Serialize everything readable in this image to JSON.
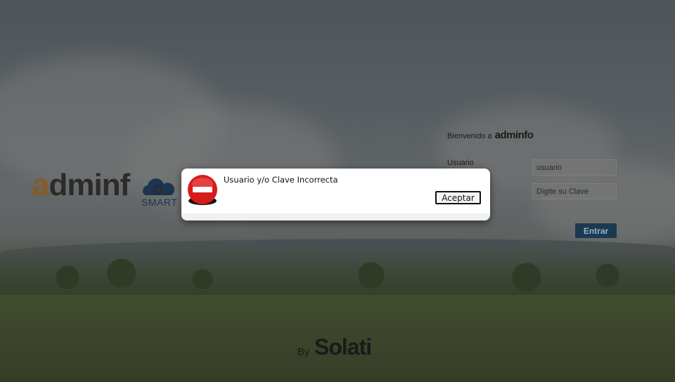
{
  "brand": {
    "logo_main_a": "a",
    "logo_main_rest": "dminf",
    "logo_sub": "SMART"
  },
  "login": {
    "welcome_text": "Bienvenido a",
    "welcome_brand": "adminfo",
    "user_label": "Usuario",
    "user_placeholder": "usuario",
    "password_placeholder": "Digite su Clave",
    "submit_label": "Entrar"
  },
  "footer": {
    "by_text": "By",
    "brand": "Solati"
  },
  "dialog": {
    "message": "Usuario y/o Clave Incorrecta",
    "accept_label": "Aceptar",
    "icon": "error-stop-icon"
  },
  "colors": {
    "error_red": "#d71b1b",
    "button_navy": "#1b3a52",
    "logo_brown": "#8a5a25",
    "logo_navy": "#1c3450"
  }
}
